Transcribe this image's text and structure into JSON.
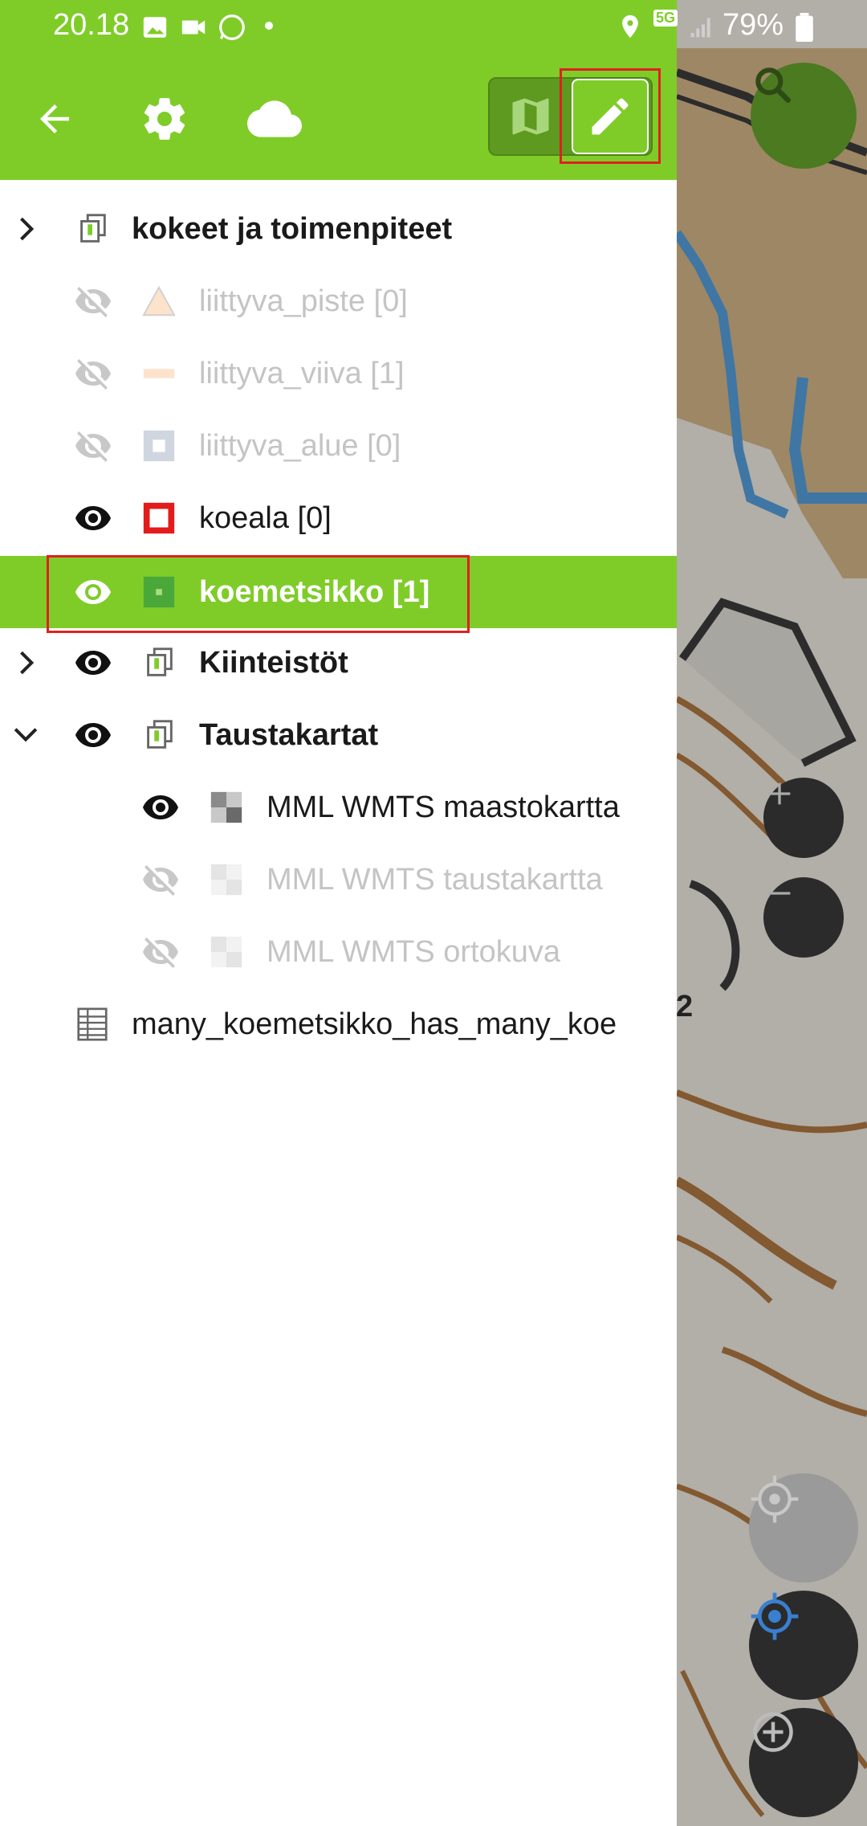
{
  "status_bar": {
    "time": "20.18",
    "battery": "79%",
    "network": "5G"
  },
  "toolbar": {
    "back": "back-arrow-icon",
    "settings": "gear-icon",
    "cloud": "cloud-icon",
    "map_toggle": "map-icon",
    "edit_toggle": "pencil-icon"
  },
  "layers": [
    {
      "label": "kokeet ja toimenpiteet",
      "kind": "group",
      "expanded": false
    },
    {
      "label": "liittyva_piste [0]",
      "kind": "point",
      "visible": false
    },
    {
      "label": "liittyva_viiva [1]",
      "kind": "line",
      "visible": false
    },
    {
      "label": "liittyva_alue [0]",
      "kind": "polygon",
      "visible": false
    },
    {
      "label": "koeala [0]",
      "kind": "polygon",
      "visible": true
    },
    {
      "label": "koemetsikko [1]",
      "kind": "polygon",
      "visible": true,
      "selected": true
    },
    {
      "label": "Kiinteistöt",
      "kind": "group",
      "visible": true,
      "expanded": false
    },
    {
      "label": "Taustakartat",
      "kind": "group",
      "visible": true,
      "expanded": true
    },
    {
      "label": "MML WMTS maastokartta",
      "kind": "raster",
      "visible": true
    },
    {
      "label": "MML WMTS taustakartta",
      "kind": "raster",
      "visible": false
    },
    {
      "label": "MML WMTS ortokuva",
      "kind": "raster",
      "visible": false
    },
    {
      "label": "many_koemetsikko_has_many_koe",
      "kind": "table"
    }
  ],
  "map": {
    "visible_label": "2",
    "buttons": [
      "search-icon",
      "zoom-in-icon",
      "zoom-out-icon",
      "gps-icon",
      "locate-icon",
      "add-feature-icon"
    ]
  },
  "colors": {
    "accent": "#7fcc29",
    "highlight": "#e02020"
  }
}
